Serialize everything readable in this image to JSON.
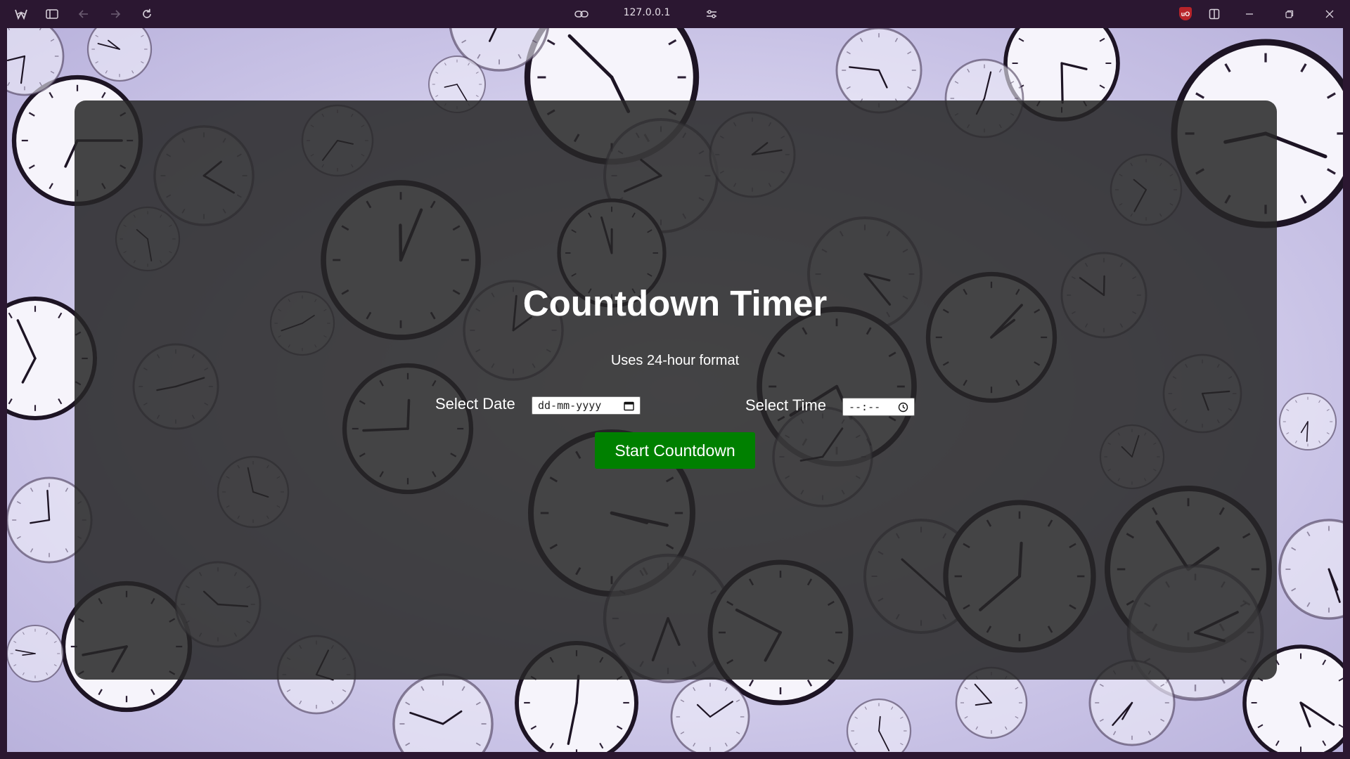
{
  "browser": {
    "url": "127.0.0.1",
    "icons": {
      "app_logo": "browser-logo-icon",
      "sidebar_toggle": "sidebar-toggle-icon",
      "back": "arrow-left-icon",
      "forward": "arrow-right-icon",
      "reload": "reload-icon",
      "link": "link-icon",
      "site_settings": "sliders-icon",
      "extension": "ublock-origin-icon",
      "split_view": "split-view-icon",
      "minimize": "minimize-icon",
      "restore": "restore-icon",
      "close": "close-icon"
    },
    "extension_badge": "uO"
  },
  "page": {
    "title": "Countdown Timer",
    "subtitle": "Uses 24-hour format",
    "date_label": "Select Date",
    "date_placeholder": "dd-mm-yyyy",
    "time_label": "Select Time",
    "time_placeholder": "--:--",
    "start_button": "Start Countdown",
    "colors": {
      "button": "#008000",
      "panel": "#262626",
      "chrome": "#2b1731"
    }
  }
}
